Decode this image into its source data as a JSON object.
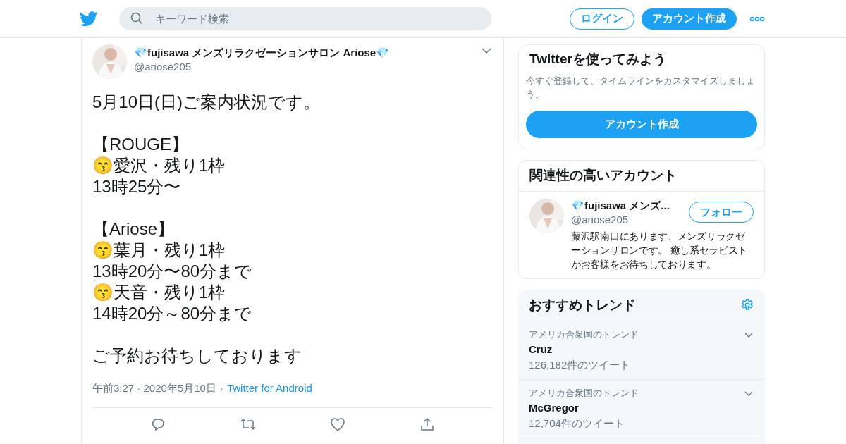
{
  "header": {
    "search": {
      "placeholder": "キーワード検索"
    },
    "login": "ログイン",
    "signup": "アカウント作成"
  },
  "tweet": {
    "name": "💎fujisawa メンズリラクゼーションサロン Ariose💎",
    "handle": "@ariose205",
    "paragraphs": [
      [
        "5月10日(日)ご案内状況です。"
      ],
      [
        "【ROUGE】",
        "😙愛沢・残り1枠",
        "13時25分〜"
      ],
      [
        "【Ariose】",
        "😙葉月・残り1枠",
        "13時20分〜80分まで",
        "😙天音・残り1枠",
        "14時20分～80分まで"
      ],
      [
        "ご予約お待ちしております"
      ]
    ],
    "time": "午前3:27 · 2020年5月10日",
    "separator": "·",
    "source": "Twitter for Android"
  },
  "signup_card": {
    "title": "Twitterを使ってみよう",
    "text": "今すぐ登録して、タイムラインをカスタマイズしましょう。",
    "button": "アカウント作成"
  },
  "related": {
    "title": "関連性の高いアカウント",
    "accounts": [
      {
        "name": "💎fujisawa メンズ...",
        "handle": "@ariose205",
        "follow": "フォロー",
        "bio": "藤沢駅南口にあります、メンズリラクゼーションサロンです。 癒し系セラピストがお客様をお待ちしております。"
      }
    ]
  },
  "trends": {
    "title": "おすすめトレンド",
    "items": [
      {
        "context": "アメリカ合衆国のトレンド",
        "name": "Cruz",
        "count": "126,182件のツイート"
      },
      {
        "context": "アメリカ合衆国のトレンド",
        "name": "McGregor",
        "count": "12,704件のツイート"
      }
    ]
  }
}
